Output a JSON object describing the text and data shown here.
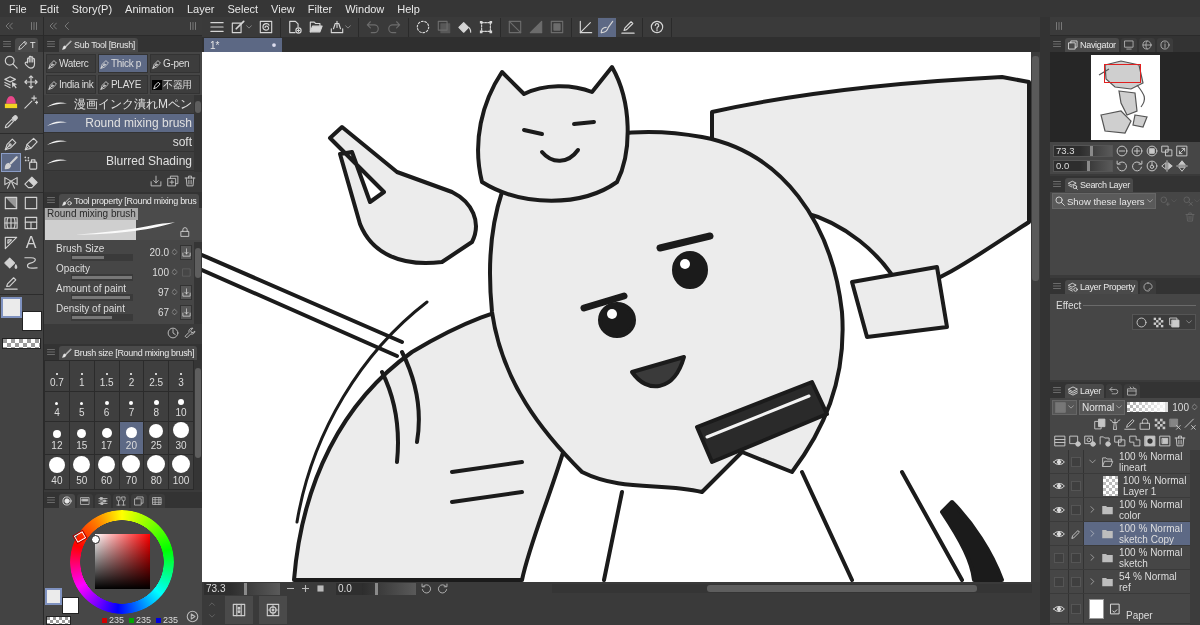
{
  "menu": [
    "File",
    "Edit",
    "Story(P)",
    "Animation",
    "Layer",
    "Select",
    "View",
    "Filter",
    "Window",
    "Help"
  ],
  "tool_palette": {
    "tab_label": "T",
    "tool_groups": [
      {
        "tools": [
          {
            "selected": false
          },
          {
            "selected": false
          },
          {
            "selected": false
          },
          {
            "selected": false
          },
          {
            "selected": false
          },
          {
            "selected": false
          },
          {
            "selected": false
          }
        ]
      },
      {
        "tools": [
          {
            "selected": false
          },
          {
            "selected": false
          },
          {
            "selected": true
          },
          {
            "selected": false
          },
          {
            "selected": false
          },
          {
            "selected": false
          }
        ]
      },
      {
        "tools": [
          {
            "selected": false
          },
          {
            "selected": false
          },
          {
            "selected": false
          },
          {
            "selected": false
          },
          {
            "selected": false
          },
          {
            "glyph": "A",
            "selected": false
          },
          {
            "selected": false
          },
          {
            "selected": false
          },
          {
            "selected": false
          }
        ]
      }
    ],
    "color_slots": [
      {
        "color": "#ebebeb",
        "selected": true
      },
      {
        "color": "#ffffff",
        "selected": false
      }
    ]
  },
  "sub_tool": {
    "title": "Sub Tool [Brush]",
    "groups": [
      {
        "label": "Waterc",
        "selected": false
      },
      {
        "label": "Thick p",
        "selected": true
      },
      {
        "label": "G-pen",
        "selected": false
      },
      {
        "label": "India ink",
        "selected": false
      },
      {
        "label": "PLAYE",
        "selected": false
      },
      {
        "label": "不器用",
        "selected": false
      }
    ],
    "brushes": [
      {
        "label": "漫画インク潰れMペン",
        "selected": false
      },
      {
        "label": "Round mixing brush",
        "selected": true
      },
      {
        "label": "soft",
        "selected": false
      },
      {
        "label": "Blurred Shading",
        "selected": false
      }
    ]
  },
  "tool_property": {
    "title": "Tool property [Round mixing brus",
    "preview_label": "Round mixing brush",
    "properties": [
      {
        "kind": "pressure",
        "label": "Brush Size",
        "value": "20.0",
        "level": 0.54
      },
      {
        "kind": "toggle",
        "label": "Opacity",
        "value": "100",
        "level": 1
      },
      {
        "kind": "pressure",
        "label": "Amount of paint",
        "value": "97",
        "level": 0.97
      },
      {
        "kind": "pressure",
        "label": "Density of paint",
        "value": "67",
        "level": 0.67
      }
    ]
  },
  "brush_size": {
    "title": "Brush size [Round mixing brush]",
    "sizes": [
      {
        "label": "0.7",
        "selected": false
      },
      {
        "label": "1",
        "selected": false
      },
      {
        "label": "1.5",
        "selected": false
      },
      {
        "label": "2",
        "selected": false
      },
      {
        "label": "2.5",
        "selected": false
      },
      {
        "label": "3",
        "selected": false
      },
      {
        "label": "4",
        "selected": false
      },
      {
        "label": "5",
        "selected": false
      },
      {
        "label": "6",
        "selected": false
      },
      {
        "label": "7",
        "selected": false
      },
      {
        "label": "8",
        "selected": false
      },
      {
        "label": "10",
        "selected": false
      },
      {
        "label": "12",
        "selected": false
      },
      {
        "label": "15",
        "selected": false
      },
      {
        "label": "17",
        "selected": false
      },
      {
        "label": "20",
        "selected": true
      },
      {
        "label": "25",
        "selected": false
      },
      {
        "label": "30",
        "selected": false
      },
      {
        "label": "40",
        "selected": false
      },
      {
        "label": "50",
        "selected": false
      },
      {
        "label": "60",
        "selected": false
      },
      {
        "label": "70",
        "selected": false
      },
      {
        "label": "80",
        "selected": false
      },
      {
        "label": "100",
        "selected": false
      }
    ]
  },
  "color_panel": {
    "tabs": [
      {
        "selected": true
      },
      {
        "selected": false
      },
      {
        "selected": false
      },
      {
        "selected": false
      },
      {
        "selected": false
      },
      {
        "selected": false
      }
    ],
    "color_slots": [
      {
        "color": "#ebebeb",
        "selected": true
      },
      {
        "color": "#ffffff",
        "selected": false
      }
    ],
    "channels": [
      {
        "color": "#d10000",
        "value": "235"
      },
      {
        "color": "#00a800",
        "value": "235"
      },
      {
        "color": "#0000e0",
        "value": "235"
      }
    ]
  },
  "canvas_toolbar": [
    {
      "items": [
        {
          "selected": false,
          "disabled": false
        },
        {
          "selected": false,
          "disabled": false
        },
        {
          "selected": false,
          "disabled": false
        }
      ]
    },
    {
      "items": [
        {
          "selected": false,
          "disabled": false
        },
        {
          "selected": false,
          "disabled": false
        },
        {
          "selected": false,
          "disabled": false
        }
      ]
    },
    {
      "items": [
        {
          "selected": false,
          "disabled": true
        },
        {
          "selected": false,
          "disabled": true
        }
      ]
    },
    {
      "items": [
        {
          "selected": false,
          "disabled": false
        },
        {
          "selected": false,
          "disabled": true
        },
        {
          "selected": false,
          "disabled": false
        },
        {
          "selected": false,
          "disabled": false
        }
      ]
    },
    {
      "items": [
        {
          "selected": false,
          "disabled": true
        },
        {
          "selected": false,
          "disabled": true
        },
        {
          "selected": false,
          "disabled": true
        }
      ]
    },
    {
      "items": [
        {
          "selected": false,
          "disabled": false
        },
        {
          "selected": true,
          "disabled": false
        },
        {
          "selected": false,
          "disabled": false
        }
      ]
    },
    {
      "items": [
        {
          "selected": false,
          "disabled": false
        }
      ]
    }
  ],
  "canvas": {
    "tabs": [
      {
        "label": "1*",
        "selected": true
      }
    ],
    "zoom": {
      "value": "73.3",
      "level": 0.3
    },
    "rotation": {
      "value": "0.0",
      "level": 0.25
    }
  },
  "navigator": {
    "tabs": [
      {
        "label": "Navigator",
        "selected": true
      },
      {
        "selected": false
      },
      {
        "selected": false
      },
      {
        "selected": false
      }
    ],
    "zoom": {
      "value": "73.3",
      "level": 0.33
    },
    "rotation": {
      "value": "0.0",
      "level": 0.25
    }
  },
  "search_layer": {
    "title": "Search Layer",
    "filter": "Show these layers"
  },
  "layer_property": {
    "tabs": [
      {
        "label": "Layer Property",
        "selected": true
      },
      {
        "selected": false
      }
    ],
    "section": "Effect"
  },
  "layer_panel": {
    "tabs": [
      {
        "label": "Layer",
        "selected": true
      },
      {
        "selected": false
      },
      {
        "selected": false
      }
    ],
    "blend_mode": "Normal",
    "opacity": {
      "value": "100",
      "level": 1
    },
    "layers": [
      {
        "kind": "folder",
        "blend": "100 % Normal",
        "name": "lineart",
        "visible": true,
        "editing": false,
        "selected": false,
        "expanded": true,
        "children": [
          {
            "kind": "raster",
            "blend": "100 % Normal",
            "name": "Layer 1",
            "visible": true,
            "editing": false,
            "selected": false
          }
        ]
      },
      {
        "kind": "folder",
        "blend": "100 % Normal",
        "name": "color",
        "visible": true,
        "editing": false,
        "selected": false,
        "expanded": false
      },
      {
        "kind": "folder",
        "blend": "100 % Normal",
        "name": "sketch Copy",
        "visible": true,
        "editing": true,
        "selected": true,
        "expanded": false
      },
      {
        "kind": "folder",
        "blend": "100 % Normal",
        "name": "sketch",
        "visible": false,
        "editing": false,
        "selected": false,
        "expanded": false
      },
      {
        "kind": "folder",
        "blend": "54 % Normal",
        "name": "ref",
        "visible": false,
        "editing": false,
        "selected": false,
        "expanded": false
      },
      {
        "kind": "paper",
        "name": "Paper",
        "visible": true,
        "editing": false,
        "selected": false
      }
    ]
  }
}
